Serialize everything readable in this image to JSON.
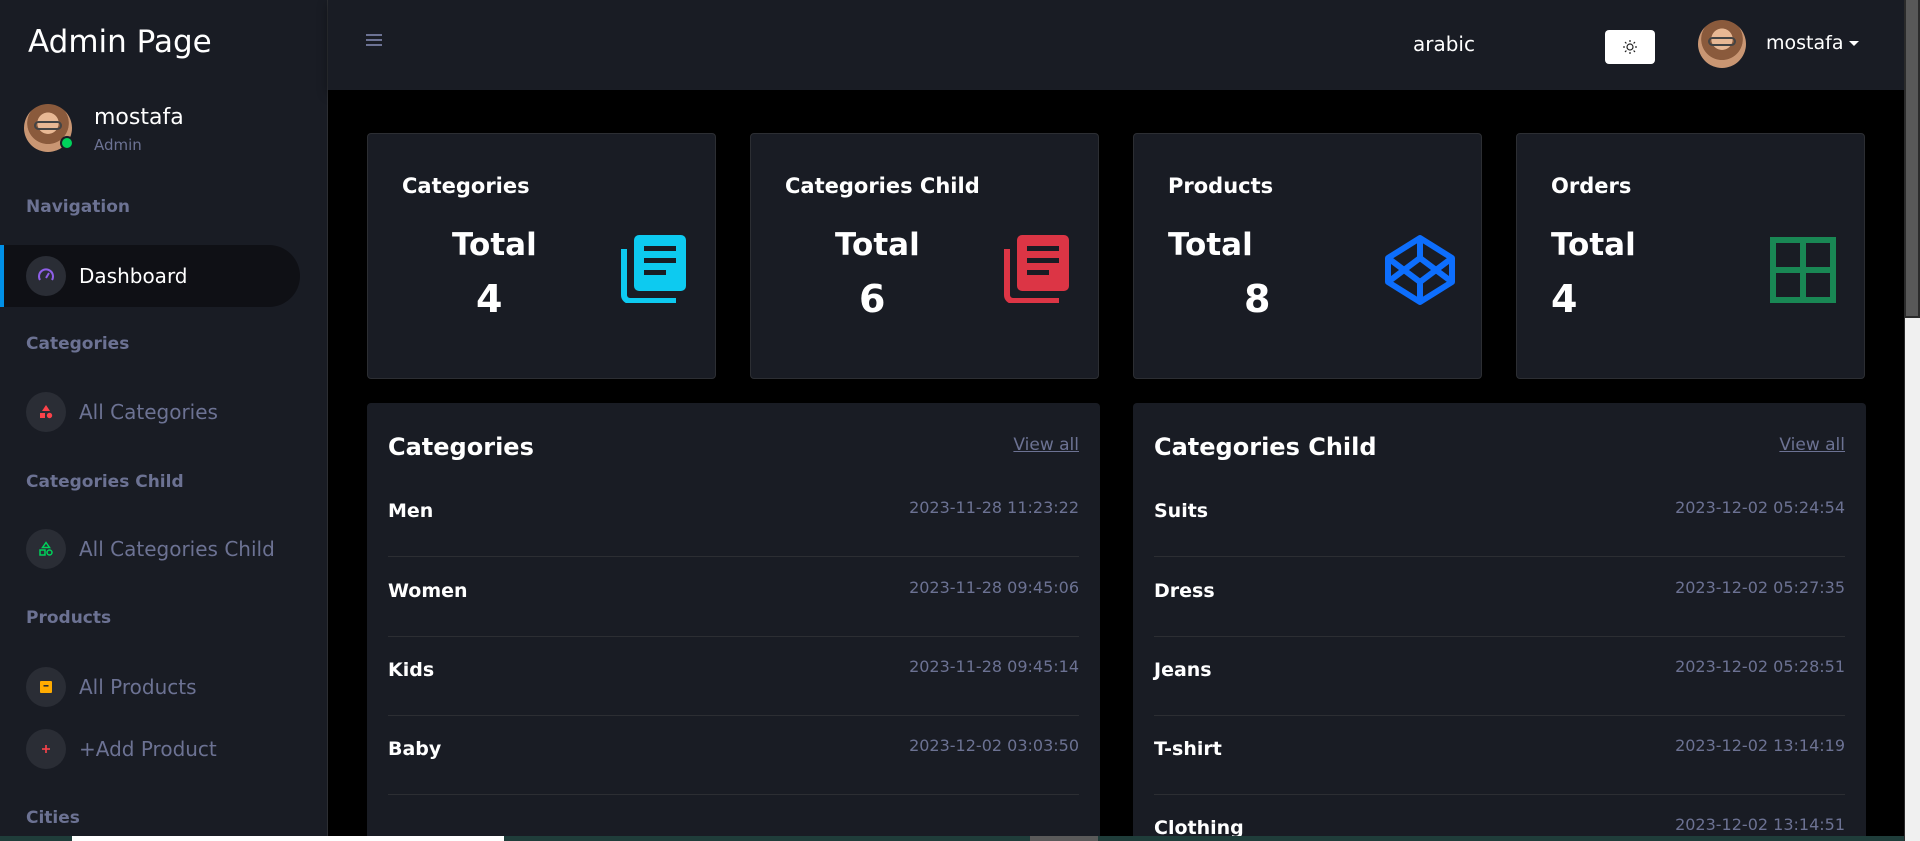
{
  "app": {
    "brand": "Admin Page"
  },
  "profile": {
    "name": "mostafa",
    "role": "Admin"
  },
  "sidebar": {
    "headings": [
      "Navigation",
      "Categories",
      "Categories Child",
      "Products",
      "Cities"
    ],
    "items": [
      {
        "label": "Dashboard",
        "icon": "speedometer-icon",
        "active": true
      },
      {
        "label": "All Categories",
        "icon": "shapes-icon",
        "color": "#fc424a"
      },
      {
        "label": "All Categories Child",
        "icon": "shapes-outline-icon",
        "color": "#00d25b"
      },
      {
        "label": "All Products",
        "icon": "archive-icon",
        "color": "#ffab00"
      },
      {
        "label": "+Add Product",
        "icon": "plus-icon",
        "color": "#fc424a"
      }
    ]
  },
  "topbar": {
    "language": "arabic",
    "username": "mostafa",
    "theme_icon": "sun-icon"
  },
  "stats": [
    {
      "title": "Categories",
      "total_label": "Total",
      "value": "4",
      "icon": "document-icon",
      "color": "#0dcaf0"
    },
    {
      "title": "Categories Child",
      "total_label": "Total",
      "value": "6",
      "icon": "document-icon",
      "color": "#dc3545"
    },
    {
      "title": "Products",
      "total_label": "Total",
      "value": "8",
      "icon": "codepen-icon",
      "color": "#0d6efd"
    },
    {
      "title": "Orders",
      "total_label": "Total",
      "value": "4",
      "icon": "grid-icon",
      "color": "#198754"
    }
  ],
  "lists": [
    {
      "title": "Categories",
      "view_all": "View all",
      "rows": [
        {
          "name": "Men",
          "date": "2023-11-28 11:23:22"
        },
        {
          "name": "Women",
          "date": "2023-11-28 09:45:06"
        },
        {
          "name": "Kids",
          "date": "2023-11-28 09:45:14"
        },
        {
          "name": "Baby",
          "date": "2023-12-02 03:03:50"
        }
      ]
    },
    {
      "title": "Categories Child",
      "view_all": "View all",
      "rows": [
        {
          "name": "Suits",
          "date": "2023-12-02 05:24:54"
        },
        {
          "name": "Dress",
          "date": "2023-12-02 05:27:35"
        },
        {
          "name": "Jeans",
          "date": "2023-12-02 05:28:51"
        },
        {
          "name": "T-shirt",
          "date": "2023-12-02 13:14:19"
        },
        {
          "name": "Clothing",
          "date": "2023-12-02 13:14:51"
        }
      ]
    }
  ]
}
